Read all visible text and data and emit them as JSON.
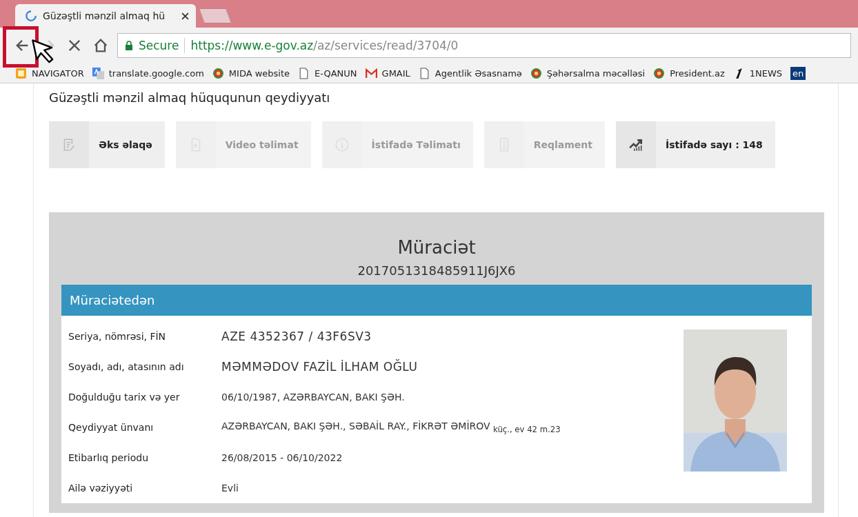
{
  "browser": {
    "tabs": [
      {
        "title": "Güzəştli mənzil almaq hü",
        "selected": true
      },
      {
        "selected": false
      }
    ],
    "address": {
      "security": "Secure",
      "host": "https://www.e-gov.az",
      "path": "/az/services/read/3704/0"
    },
    "bookmarks": [
      "NAVIGATOR",
      "translate.google.com",
      "MIDA website",
      "E-QANUN",
      "GMAIL",
      "Agentlik Əsasnamə",
      "Şəhərsalma məcəlləsi",
      "President.az",
      "1NEWS",
      "en"
    ]
  },
  "page": {
    "title": "Güzəştli mənzil almaq hüququnun qeydiyyatı",
    "actions": [
      {
        "label": "Əks əlaqə",
        "disabled": false
      },
      {
        "label": "Video təlimat",
        "disabled": true
      },
      {
        "label": "İstifadə Təlimatı",
        "disabled": true
      },
      {
        "label": "Reqlament",
        "disabled": true
      },
      {
        "label": "İstifadə sayı : 148",
        "disabled": false
      }
    ],
    "application": {
      "title": "Müraciət",
      "number": "2017051318485911J6JX6",
      "section": "Müraciətedən",
      "rows": [
        {
          "label": "Seriya, nömrəsi, FİN",
          "value": "AZE 4352367 / 43F6SV3"
        },
        {
          "label": "Soyadı, adı, atasının adı",
          "value": "MƏMMƏDOV FAZİL İLHAM OĞLU"
        },
        {
          "label": "Doğulduğu tarix və yer",
          "value": "06/10/1987, AZƏRBAYCAN, BAKI ŞƏH."
        },
        {
          "label": "Qeydiyyat ünvanı",
          "value": "AZƏRBAYCAN, BAKI ŞƏH., SƏBAİL RAY., FİKRƏT ƏMİROV $_{küç., ev 42 m.23}$"
        },
        {
          "label": "Etibarlıq periodu",
          "value": "26/08/2015 - 06/10/2022"
        },
        {
          "label": "Ailə vəziyyəti",
          "value": "Evli"
        }
      ]
    }
  }
}
